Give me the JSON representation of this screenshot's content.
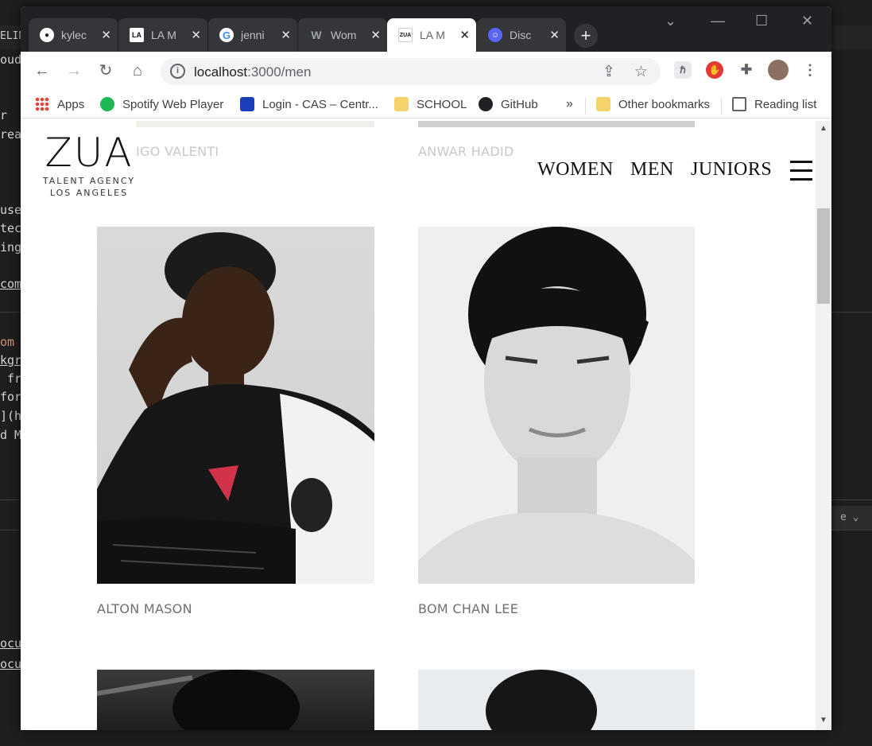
{
  "editor_fragments": {
    "top_left": "ELIN",
    "l2": "oud",
    "l3": "r",
    "l4": "rea",
    "l5": "use",
    "l6": "tec",
    "l7": "ing",
    "l8": "com",
    "l9": "om",
    "l10": "kgr",
    "l11": " fr",
    "l12": "for",
    "l13": "](h",
    "l14": "d M",
    "l15": "ocu",
    "l16": "ocu",
    "dropdown": "e"
  },
  "browser": {
    "tabs": [
      {
        "title": "kylec",
        "icon": "github-icon",
        "color": "#ffffff"
      },
      {
        "title": "LA M",
        "icon": "la-models-icon",
        "color": "#ffffff"
      },
      {
        "title": "jenni",
        "icon": "google-icon",
        "color": "#4285f4"
      },
      {
        "title": "Wom",
        "icon": "wilhelmina-icon",
        "color": "#9aa0a6"
      },
      {
        "title": "LA M",
        "icon": "zua-icon",
        "color": "#ffffff"
      },
      {
        "title": "Disc",
        "icon": "discord-icon",
        "color": "#5865f2"
      }
    ],
    "address": {
      "host": "localhost",
      "path": ":3000/men"
    },
    "bookmarks": [
      {
        "label": "Apps",
        "icon": "apps-grid-icon",
        "color": "#ea4335"
      },
      {
        "label": "Spotify Web Player",
        "icon": "spotify-icon",
        "color": "#1db954"
      },
      {
        "label": "Login - CAS – Centr...",
        "icon": "cas-login-icon",
        "color": "#1a3fb8"
      },
      {
        "label": "SCHOOL",
        "icon": "folder-icon",
        "color": "#f5d36b"
      },
      {
        "label": "GitHub",
        "icon": "github-icon",
        "color": "#202124"
      }
    ],
    "overflow": "»",
    "other_bookmarks": "Other bookmarks",
    "reading_list": "Reading list"
  },
  "page": {
    "logo": {
      "main": "ZUA",
      "line1": "TALENT AGENCY",
      "line2": "LOS ANGELES"
    },
    "nav": [
      {
        "label": "WOMEN"
      },
      {
        "label": "MEN"
      },
      {
        "label": "JUNIORS"
      }
    ],
    "models_prev": [
      {
        "name": "IGO VALENTI"
      },
      {
        "name": "ANWAR HADID"
      }
    ],
    "models": [
      {
        "name": "ALTON MASON"
      },
      {
        "name": "BOM CHAN LEE"
      }
    ]
  }
}
